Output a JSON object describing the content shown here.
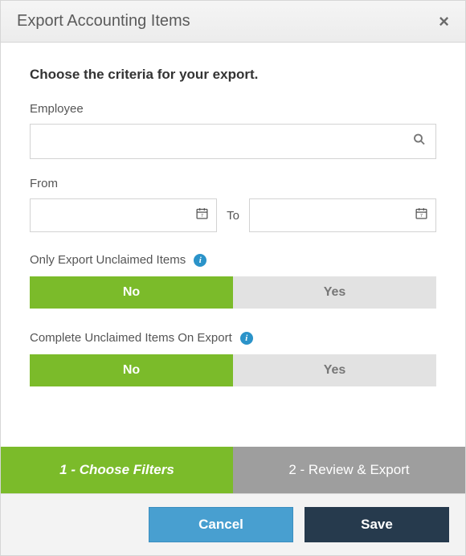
{
  "dialog": {
    "title": "Export Accounting Items",
    "instruction": "Choose the criteria for your export."
  },
  "employee": {
    "label": "Employee",
    "value": ""
  },
  "dates": {
    "from_label": "From",
    "from_value": "",
    "to_label": "To",
    "to_value": ""
  },
  "toggle_unclaimed": {
    "label": "Only Export Unclaimed Items",
    "no": "No",
    "yes": "Yes",
    "selected": "No"
  },
  "toggle_complete": {
    "label": "Complete Unclaimed Items On Export",
    "no": "No",
    "yes": "Yes",
    "selected": "No"
  },
  "steps": {
    "step1": "1 - Choose Filters",
    "step2": "2 - Review & Export"
  },
  "footer": {
    "cancel": "Cancel",
    "save": "Save"
  },
  "icons": {
    "info": "i"
  }
}
